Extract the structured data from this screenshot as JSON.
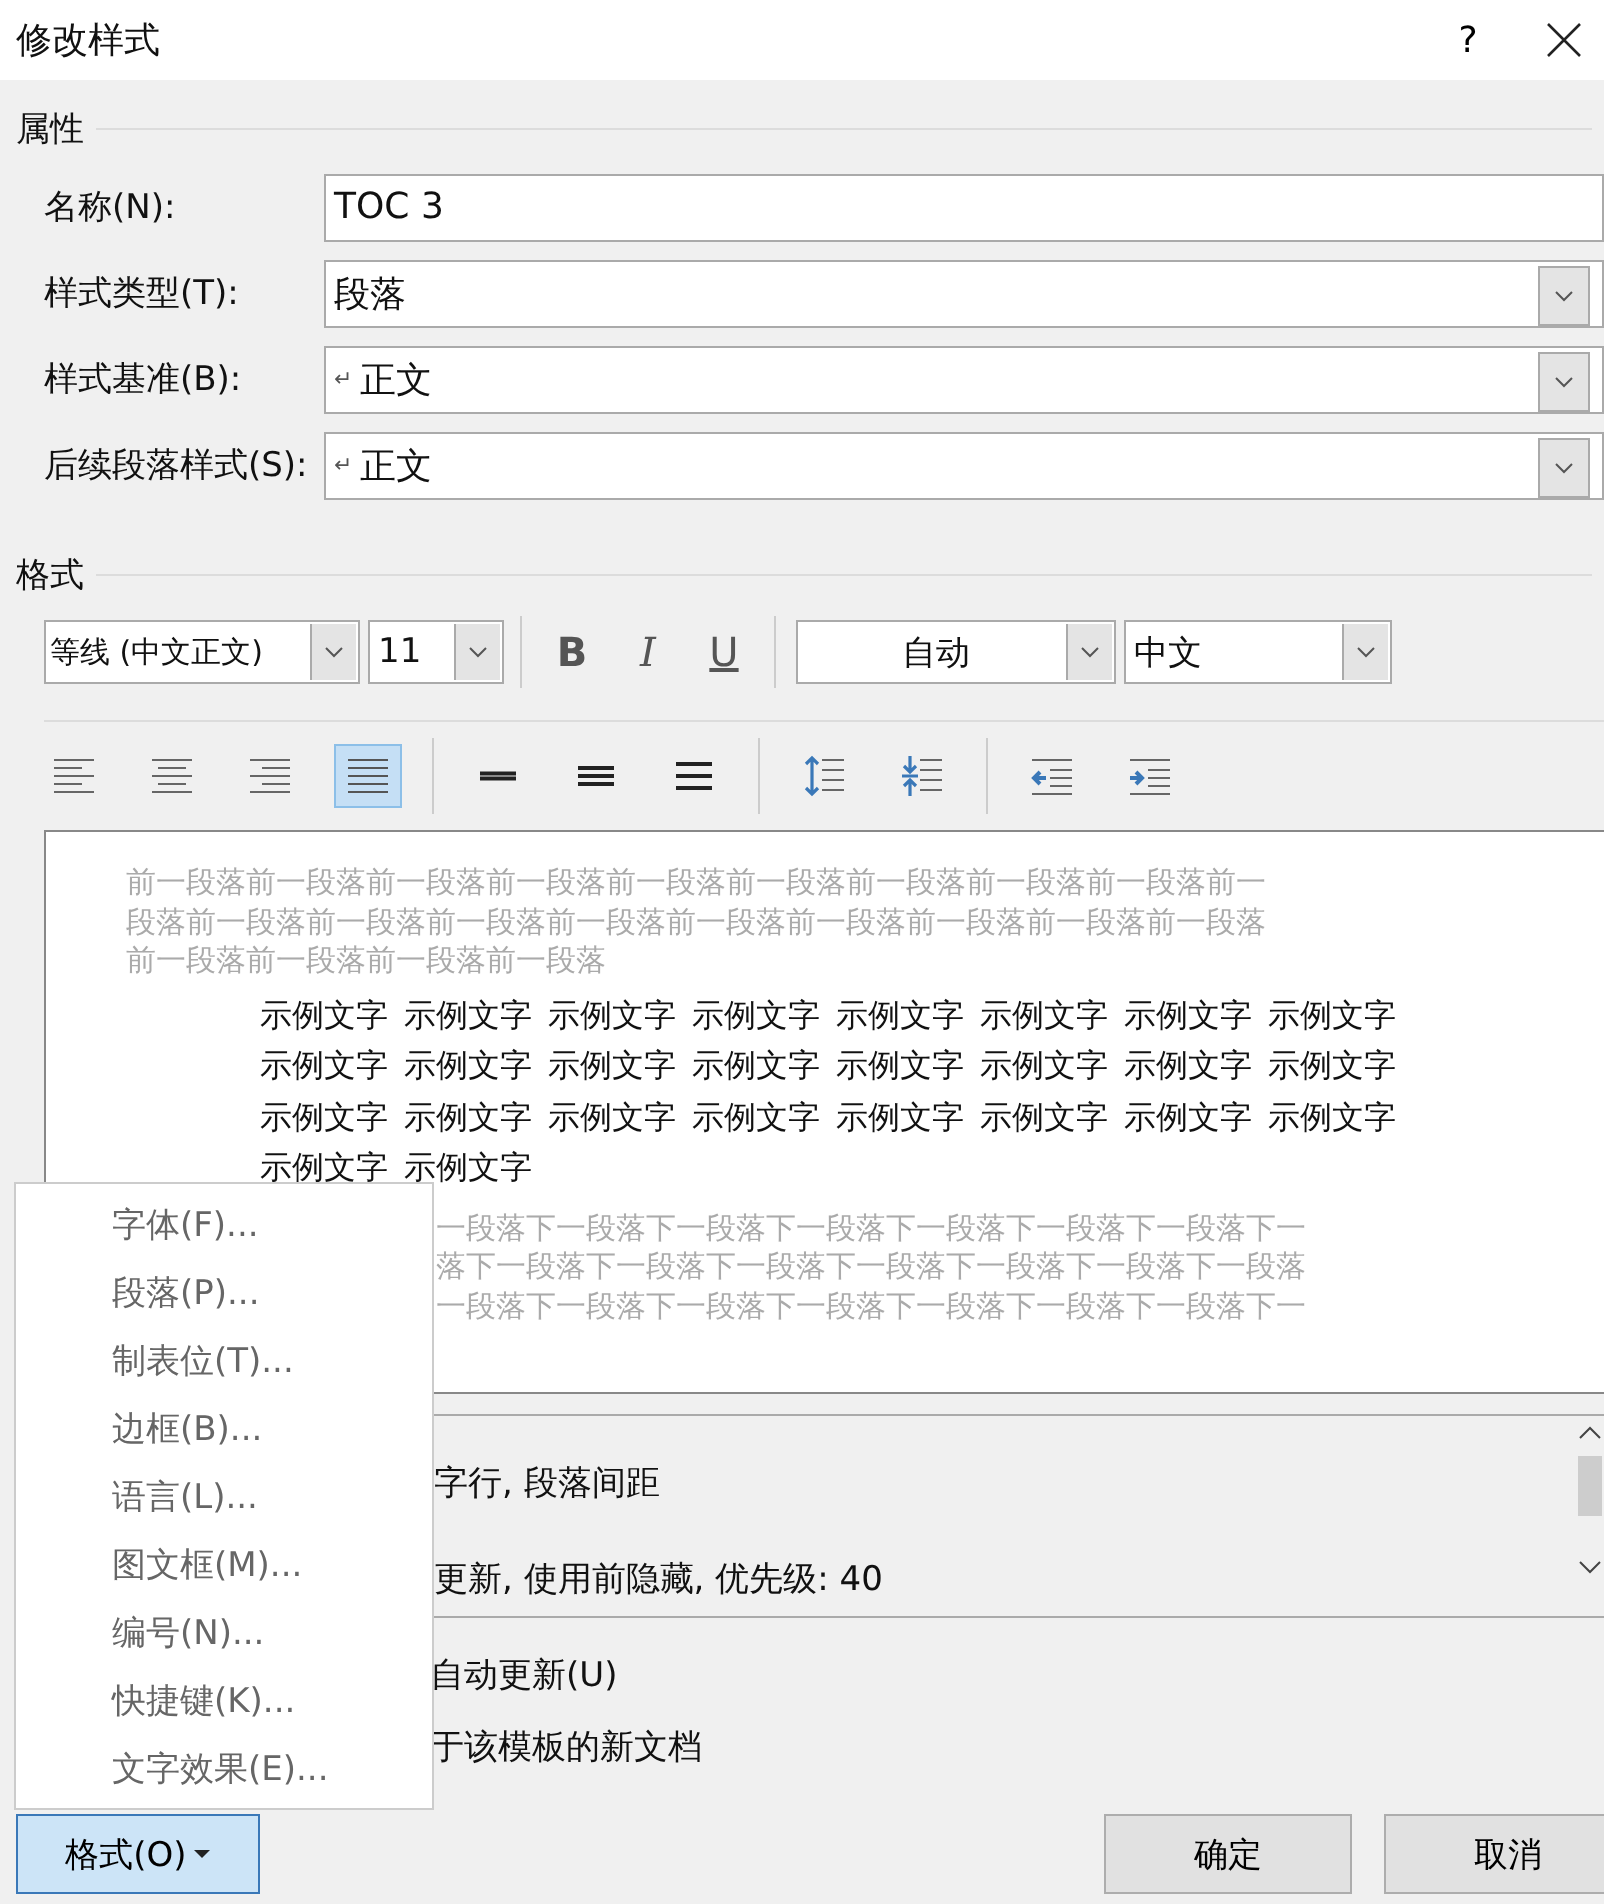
{
  "window": {
    "title": "修改样式",
    "help": "?"
  },
  "properties": {
    "heading": "属性",
    "fields": [
      {
        "label": "名称(N):",
        "kind": "text",
        "value": "TOC 3"
      },
      {
        "label": "样式类型(T):",
        "kind": "dropdown",
        "value": "段落"
      },
      {
        "label": "样式基准(B):",
        "kind": "dropdown",
        "value": "正文",
        "para_mark": "↵"
      },
      {
        "label": "后续段落样式(S):",
        "kind": "dropdown",
        "value": "正文",
        "para_mark": "↵"
      }
    ]
  },
  "format": {
    "heading": "格式",
    "font": "等线 (中文正文)",
    "size": "11",
    "bold": "B",
    "italic": "I",
    "underline": "U",
    "font_color": "自动",
    "script": "中文",
    "tool_groups": [
      [
        {
          "kind": "align-left",
          "selected": false
        },
        {
          "kind": "align-center",
          "selected": false
        },
        {
          "kind": "align-right",
          "selected": false
        },
        {
          "kind": "justify",
          "selected": true
        }
      ],
      [
        {
          "kind": "single-spacing",
          "selected": false
        },
        {
          "kind": "one-half-spacing",
          "selected": false
        },
        {
          "kind": "double-spacing",
          "selected": false
        }
      ],
      [
        {
          "kind": "space-increase",
          "selected": false
        },
        {
          "kind": "space-decrease",
          "selected": false
        }
      ],
      [
        {
          "kind": "outdent",
          "selected": false
        },
        {
          "kind": "indent",
          "selected": false
        }
      ]
    ]
  },
  "preview": {
    "previous_lines": [
      "前一段落前一段落前一段落前一段落前一段落前一段落前一段落前一段落前一段落前一",
      "段落前一段落前一段落前一段落前一段落前一段落前一段落前一段落前一段落前一段落",
      "前一段落前一段落前一段落前一段落"
    ],
    "sample_lines": [
      [
        "示例文字",
        "示例文字",
        "示例文字",
        "示例文字",
        "示例文字",
        "示例文字",
        "示例文字",
        "示例文字"
      ],
      [
        "示例文字",
        "示例文字",
        "示例文字",
        "示例文字",
        "示例文字",
        "示例文字",
        "示例文字",
        "示例文字"
      ],
      [
        "示例文字",
        "示例文字",
        "示例文字",
        "示例文字",
        "示例文字",
        "示例文字",
        "示例文字",
        "示例文字"
      ],
      [
        "示例文字",
        "示例文字"
      ]
    ],
    "next_lines": [
      "一段落下一段落下一段落下一段落下一段落下一段落下一段落下一",
      "落下一段落下一段落下一段落下一段落下一段落下一段落下一段落",
      "一段落下一段落下一段落下一段落下一段落下一段落下一段落下一"
    ]
  },
  "description": [
    "字行, 段落间距",
    "更新, 使用前隐藏, 优先级: 40"
  ],
  "options": [
    "自动更新(U)",
    "于该模板的新文档"
  ],
  "menu": {
    "items": [
      "字体(F)...",
      "段落(P)...",
      "制表位(T)...",
      "边框(B)...",
      "语言(L)...",
      "图文框(M)...",
      "编号(N)...",
      "快捷键(K)...",
      "文字效果(E)..."
    ]
  },
  "buttons": {
    "format": {
      "label": "格式(O)",
      "pressed": true
    },
    "ok": "确定",
    "cancel": "取消"
  }
}
